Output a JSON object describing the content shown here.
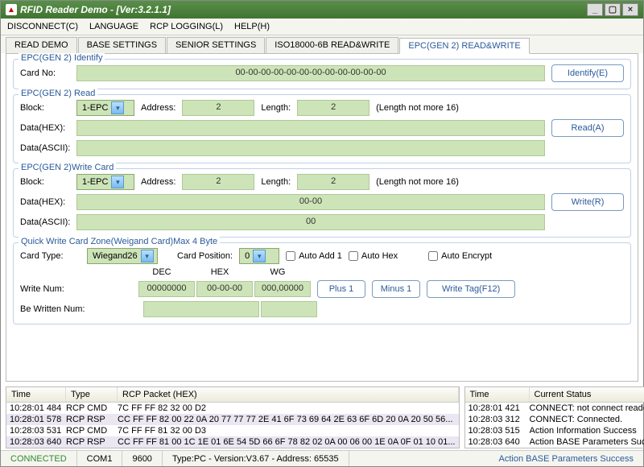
{
  "window": {
    "title": "RFID Reader Demo - [Ver:3.2.1.1]"
  },
  "menu": {
    "disconnect": "DISCONNECT(C)",
    "language": "LANGUAGE",
    "rcp_logging": "RCP LOGGING(L)",
    "help": "HELP(H)"
  },
  "tabs": {
    "read_demo": "READ DEMO",
    "base_settings": "BASE SETTINGS",
    "senior_settings": "SENIOR SETTINGS",
    "iso18000": "ISO18000-6B READ&WRITE",
    "epc_gen2": "EPC(GEN 2) READ&WRITE"
  },
  "identify": {
    "title": "EPC(GEN 2) Identify",
    "card_no_label": "Card No:",
    "card_no": "00-00-00-00-00-00-00-00-00-00-00-00",
    "btn": "Identify(E)"
  },
  "read": {
    "title": "EPC(GEN 2) Read",
    "block_label": "Block:",
    "block": "1-EPC",
    "addr_label": "Address:",
    "addr": "2",
    "len_label": "Length:",
    "len": "2",
    "hint": "(Length not more 16)",
    "datahex_label": "Data(HEX):",
    "dataascii_label": "Data(ASCII):",
    "btn": "Read(A)"
  },
  "write": {
    "title": "EPC(GEN 2)Write Card",
    "block_label": "Block:",
    "block": "1-EPC",
    "addr_label": "Address:",
    "addr": "2",
    "len_label": "Length:",
    "len": "2",
    "hint": "(Length not more 16)",
    "datahex_label": "Data(HEX):",
    "datahex": "00-00",
    "dataascii_label": "Data(ASCII):",
    "dataascii": "00",
    "btn": "Write(R)"
  },
  "quick": {
    "title": "Quick Write Card Zone(Weigand Card)Max 4 Byte",
    "cardtype_label": "Card Type:",
    "cardtype": "Wiegand26",
    "cardpos_label": "Card Position:",
    "cardpos": "0",
    "auto_add1": "Auto Add 1",
    "auto_hex": "Auto Hex",
    "auto_encrypt": "Auto Encrypt",
    "dec_h": "DEC",
    "hex_h": "HEX",
    "wg_h": "WG",
    "writenum_label": "Write Num:",
    "dec": "00000000",
    "hex": "00-00-00",
    "wg": "000,00000",
    "plus": "Plus 1",
    "minus": "Minus 1",
    "writetag": "Write Tag(F12)",
    "bewritten_label": "Be Written Num:"
  },
  "log_left": {
    "h_time": "Time",
    "h_type": "Type",
    "h_packet": "RCP Packet (HEX)",
    "rows": [
      {
        "t": "10:28:01 484",
        "ty": "RCP CMD",
        "p": "7C FF FF 82 32 00 D2"
      },
      {
        "t": "10:28:01 578",
        "ty": "RCP RSP",
        "p": "CC FF FF 82 00 22 0A 20 77 77 77 2E 41 6F 73 69 64 2E 63 6F 6D 20 0A 20 50 56..."
      },
      {
        "t": "10:28:03 531",
        "ty": "RCP CMD",
        "p": "7C FF FF 81 32 00 D3"
      },
      {
        "t": "10:28:03 640",
        "ty": "RCP RSP",
        "p": "CC FF FF 81 00 1C 1E 01 6E 54 5D 66 6F 78 82 02 0A 00 06 00 1E 0A 0F 01 10 01..."
      }
    ]
  },
  "log_right": {
    "h_time": "Time",
    "h_status": "Current Status",
    "rows": [
      {
        "t": "10:28:01 421",
        "s": "CONNECT: not connect reader,connecti..."
      },
      {
        "t": "10:28:03 312",
        "s": "CONNECT: Connected."
      },
      {
        "t": "10:28:03 515",
        "s": "Action Information Success"
      },
      {
        "t": "10:28:03 640",
        "s": "Action BASE Parameters Success"
      }
    ]
  },
  "status": {
    "connected": "CONNECTED",
    "port": "COM1",
    "baud": "9600",
    "info": "Type:PC - Version:V3.67 - Address: 65535",
    "msg": "Action BASE Parameters Success"
  }
}
